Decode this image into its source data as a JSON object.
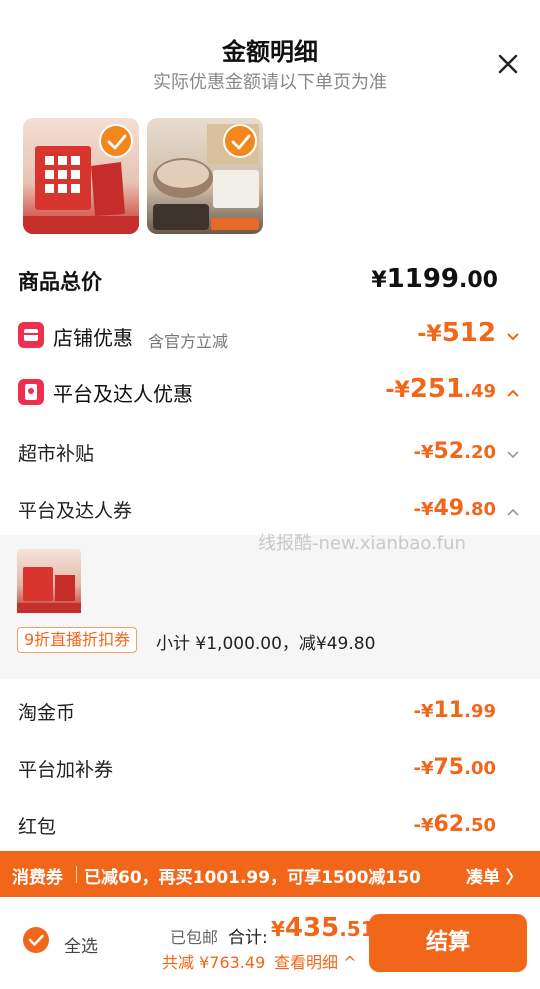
{
  "header": {
    "title": "金额明细",
    "subtitle": "实际优惠金额请以下单页为准"
  },
  "products": [
    {
      "name": "product-1",
      "selected": true
    },
    {
      "name": "product-2",
      "selected": true
    }
  ],
  "total_goods": {
    "label": "商品总价",
    "currency": "¥",
    "integer": "1199",
    "decimal": ".00"
  },
  "shop_discount": {
    "label": "店铺优惠",
    "note": "含官方立减",
    "prefix": "-¥",
    "integer": "512",
    "decimal": ""
  },
  "platform_discount": {
    "label": "平台及达人优惠",
    "prefix": "-¥",
    "integer": "251",
    "decimal": ".49"
  },
  "supermarket_subsidy": {
    "label": "超市补贴",
    "prefix": "-¥",
    "integer": "52",
    "decimal": ".20"
  },
  "platform_coupon": {
    "label": "平台及达人券",
    "prefix": "-¥",
    "integer": "49",
    "decimal": ".80"
  },
  "coupon_detail": {
    "tag": "9折直播折扣券",
    "subtotal": "小计 ¥1,000.00，减¥49.80"
  },
  "watermark": "线报酷-new.xianbao.fun",
  "taojinbi": {
    "label": "淘金币",
    "prefix": "-¥",
    "integer": "11",
    "decimal": ".99"
  },
  "platform_extra": {
    "label": "平台加补券",
    "prefix": "-¥",
    "integer": "75",
    "decimal": ".00"
  },
  "red_packet": {
    "label": "红包",
    "prefix": "-¥",
    "integer": "62",
    "decimal": ".50"
  },
  "banner": {
    "tag": "消费券",
    "message": "已减60，再买1001.99，可享1500减150",
    "action": "凑单 〉"
  },
  "footer": {
    "select_all": "全选",
    "shipping": "已包邮",
    "total_label": "合计:",
    "total_currency": "¥",
    "total_integer": "435",
    "total_decimal": ".51",
    "saved": "共减 ¥763.49",
    "view_detail": "查看明细 ^",
    "checkout": "结算"
  },
  "colors": {
    "accent": "#f2661a",
    "icon_red": "#ef2f4e",
    "detail_bg": "#f6f6f6"
  },
  "icons": {
    "close": "close-icon",
    "store": "store-icon",
    "platform": "red-envelope-icon",
    "check": "check-icon",
    "chevron_down": "chevron-down-icon",
    "chevron_up": "chevron-up-icon"
  }
}
